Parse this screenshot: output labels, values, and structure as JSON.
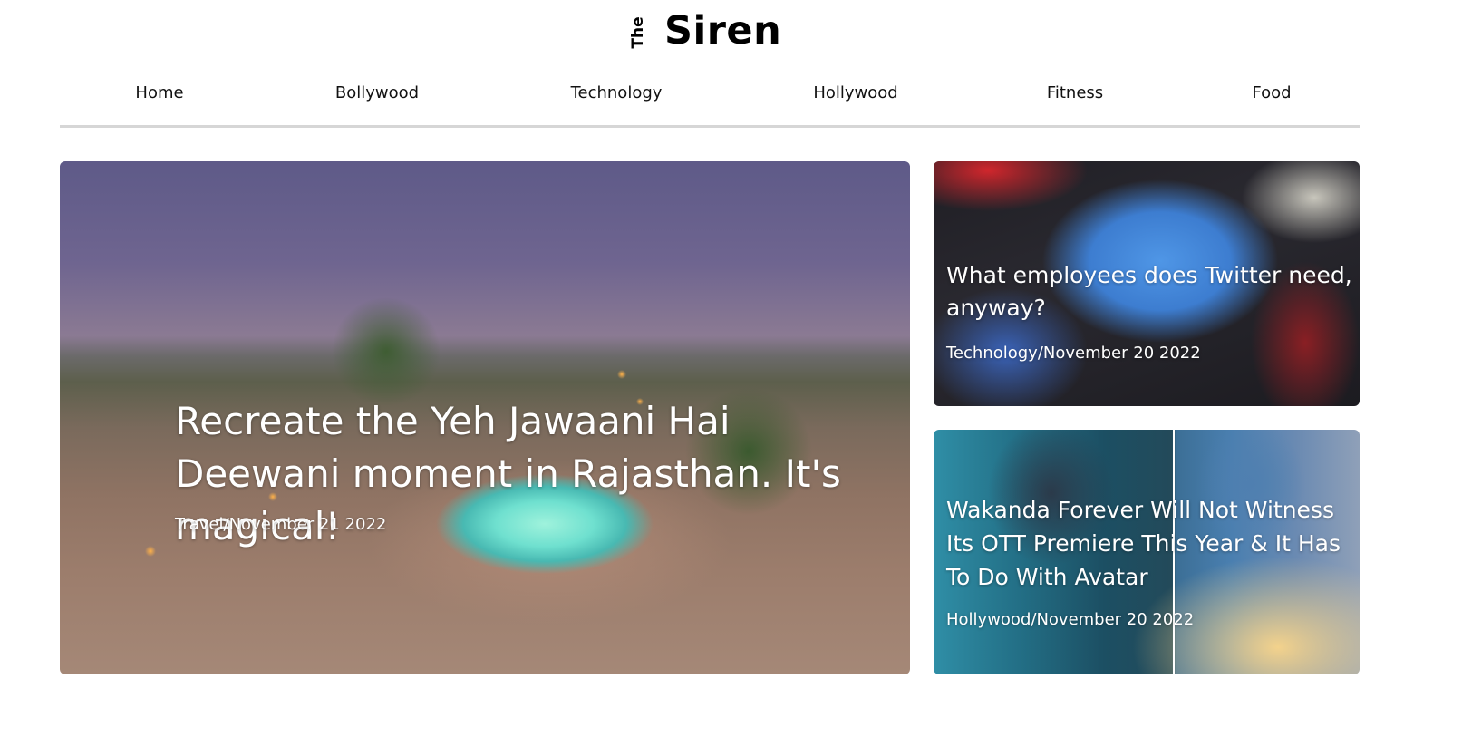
{
  "logo": {
    "the": "The",
    "name": "Siren"
  },
  "nav": {
    "items": [
      {
        "label": "Home"
      },
      {
        "label": "Bollywood"
      },
      {
        "label": "Technology"
      },
      {
        "label": "Hollywood"
      },
      {
        "label": "Fitness"
      },
      {
        "label": "Food"
      }
    ]
  },
  "articles": {
    "featured": {
      "title": "Recreate the Yeh Jawaani Hai Deewani moment in Rajasthan. It's magical!",
      "meta": "Travel/November 21 2022"
    },
    "side": [
      {
        "title": "What employees does Twitter need, anyway?",
        "meta": "Technology/November 20 2022"
      },
      {
        "title": "Wakanda Forever Will Not Witness Its OTT Premiere This Year & It Has To Do With Avatar",
        "meta": "Hollywood/November 20 2022"
      }
    ]
  }
}
